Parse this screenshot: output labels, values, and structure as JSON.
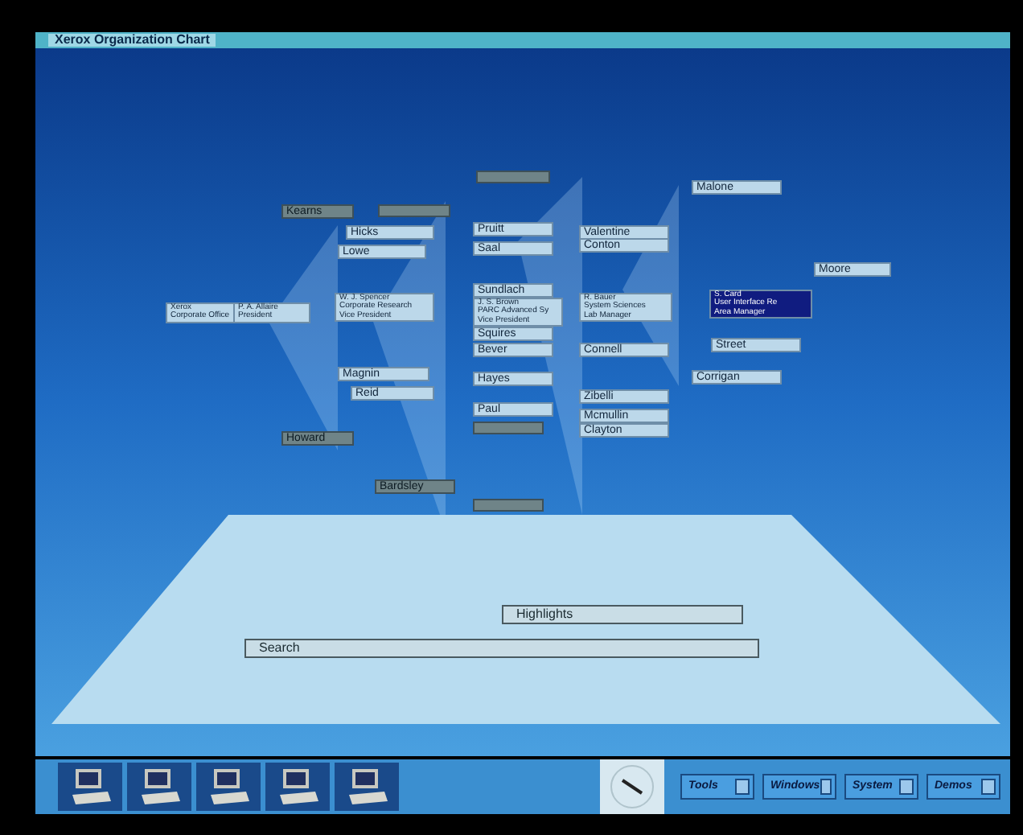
{
  "window": {
    "title": "Xerox Organization Chart"
  },
  "nodes": [
    {
      "lines": [
        "Xerox",
        "Corporate Office"
      ],
      "kind": "light",
      "selected": false
    },
    {
      "lines": [
        "P. A. Allaire",
        "President"
      ],
      "kind": "light",
      "selected": false
    },
    {
      "lines": [
        "Kearns"
      ],
      "kind": "dark",
      "selected": false
    },
    {
      "kind": "dark",
      "selected": false
    },
    {
      "lines": [
        "Hicks"
      ],
      "kind": "light",
      "selected": false
    },
    {
      "lines": [
        "Lowe"
      ],
      "kind": "light",
      "selected": false
    },
    {
      "lines": [
        "W. J. Spencer",
        "Corporate Research",
        "Vice President"
      ],
      "kind": "light",
      "selected": false
    },
    {
      "lines": [
        "Magnin"
      ],
      "kind": "light",
      "selected": false
    },
    {
      "lines": [
        "Reid"
      ],
      "kind": "light",
      "selected": false
    },
    {
      "lines": [
        "Howard"
      ],
      "kind": "dark",
      "selected": false
    },
    {
      "lines": [
        "Bardsley"
      ],
      "kind": "dark",
      "selected": false
    },
    {
      "kind": "dark",
      "selected": false
    },
    {
      "lines": [
        "Pruitt"
      ],
      "kind": "light",
      "selected": false
    },
    {
      "lines": [
        "Saal"
      ],
      "kind": "light",
      "selected": false
    },
    {
      "lines": [
        "Sundlach"
      ],
      "kind": "light",
      "selected": false
    },
    {
      "lines": [
        "J. S. Brown",
        "PARC Advanced Sy",
        "Vice President"
      ],
      "kind": "light",
      "selected": false
    },
    {
      "lines": [
        "Squires"
      ],
      "kind": "light",
      "selected": false
    },
    {
      "lines": [
        "Bever"
      ],
      "kind": "light",
      "selected": false
    },
    {
      "lines": [
        "Hayes"
      ],
      "kind": "light",
      "selected": false
    },
    {
      "lines": [
        "Paul"
      ],
      "kind": "light",
      "selected": false
    },
    {
      "kind": "dark",
      "selected": false
    },
    {
      "kind": "dark",
      "selected": false
    },
    {
      "lines": [
        "Valentine"
      ],
      "kind": "light",
      "selected": false
    },
    {
      "lines": [
        "Conton"
      ],
      "kind": "light",
      "selected": false
    },
    {
      "lines": [
        "R. Bauer",
        "System Sciences",
        "Lab Manager"
      ],
      "kind": "light",
      "selected": false
    },
    {
      "lines": [
        "Connell"
      ],
      "kind": "light",
      "selected": false
    },
    {
      "lines": [
        "Zibelli"
      ],
      "kind": "light",
      "selected": false
    },
    {
      "lines": [
        "Mcmullin"
      ],
      "kind": "light",
      "selected": false
    },
    {
      "lines": [
        "Clayton"
      ],
      "kind": "light",
      "selected": false
    },
    {
      "lines": [
        "Malone"
      ],
      "kind": "light",
      "selected": false
    },
    {
      "lines": [
        "Moore"
      ],
      "kind": "light",
      "selected": false
    },
    {
      "lines": [
        "S. Card",
        "User Interface Re",
        "Area Manager"
      ],
      "kind": "light",
      "selected": true
    },
    {
      "lines": [
        "Street"
      ],
      "kind": "light",
      "selected": false
    },
    {
      "lines": [
        "Corrigan"
      ],
      "kind": "light",
      "selected": false
    }
  ],
  "floor_buttons": [
    {
      "label": "Highlights"
    },
    {
      "label": "Search"
    }
  ],
  "taskbar": {
    "buttons": [
      {
        "label": "Tools"
      },
      {
        "label": "Windows"
      },
      {
        "label": "System"
      },
      {
        "label": "Demos"
      }
    ]
  }
}
